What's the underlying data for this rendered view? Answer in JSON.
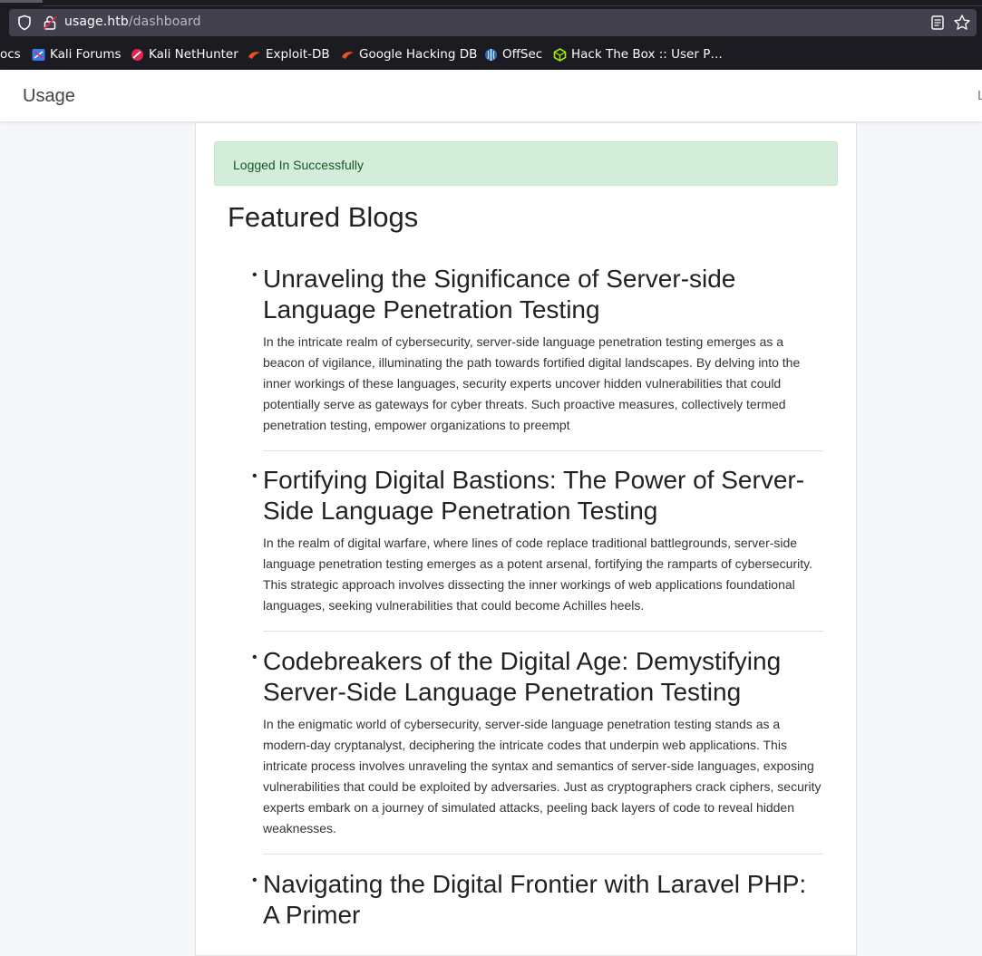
{
  "browser": {
    "url_host": "usage.htb",
    "url_path": "/dashboard",
    "bookmarks": [
      {
        "label": "ocs",
        "icon": "docs-icon"
      },
      {
        "label": "Kali Forums",
        "icon": "kali-forums-icon"
      },
      {
        "label": "Kali NetHunter",
        "icon": "kali-nethunter-icon"
      },
      {
        "label": "Exploit-DB",
        "icon": "exploit-db-icon"
      },
      {
        "label": "Google Hacking DB",
        "icon": "google-hacking-db-icon"
      },
      {
        "label": "OffSec",
        "icon": "offsec-icon"
      },
      {
        "label": "Hack The Box :: User P…",
        "icon": "hack-the-box-icon"
      }
    ]
  },
  "navbar": {
    "brand": "Usage",
    "right_edge_text": "L"
  },
  "alert": {
    "message": "Logged In Successfully"
  },
  "section": {
    "title": "Featured Blogs"
  },
  "blogs": [
    {
      "title": "Unraveling the Significance of Server-side Language Penetration Testing",
      "body": "In the intricate realm of cybersecurity, server-side language penetration testing emerges as a beacon of vigilance, illuminating the path towards fortified digital landscapes. By delving into the inner workings of these languages, security experts uncover hidden vulnerabilities that could potentially serve as gateways for cyber threats. Such proactive measures, collectively termed penetration testing, empower organizations to preempt"
    },
    {
      "title": "Fortifying Digital Bastions: The Power of Server-Side Language Penetration Testing",
      "body": "In the realm of digital warfare, where lines of code replace traditional battlegrounds, server-side language penetration testing emerges as a potent arsenal, fortifying the ramparts of cybersecurity. This strategic approach involves dissecting the inner workings of web applications foundational languages, seeking vulnerabilities that could become Achilles heels."
    },
    {
      "title": "Codebreakers of the Digital Age: Demystifying Server-Side Language Penetration Testing",
      "body": "In the enigmatic world of cybersecurity, server-side language penetration testing stands as a modern-day cryptanalyst, deciphering the intricate codes that underpin web applications. This intricate process involves unraveling the syntax and semantics of server-side languages, exposing vulnerabilities that could be exploited by adversaries. Just as cryptographers crack ciphers, security experts embark on a journey of simulated attacks, peeling back layers of code to reveal hidden weaknesses."
    },
    {
      "title": "Navigating the Digital Frontier with Laravel PHP: A Primer",
      "body": ""
    }
  ]
}
